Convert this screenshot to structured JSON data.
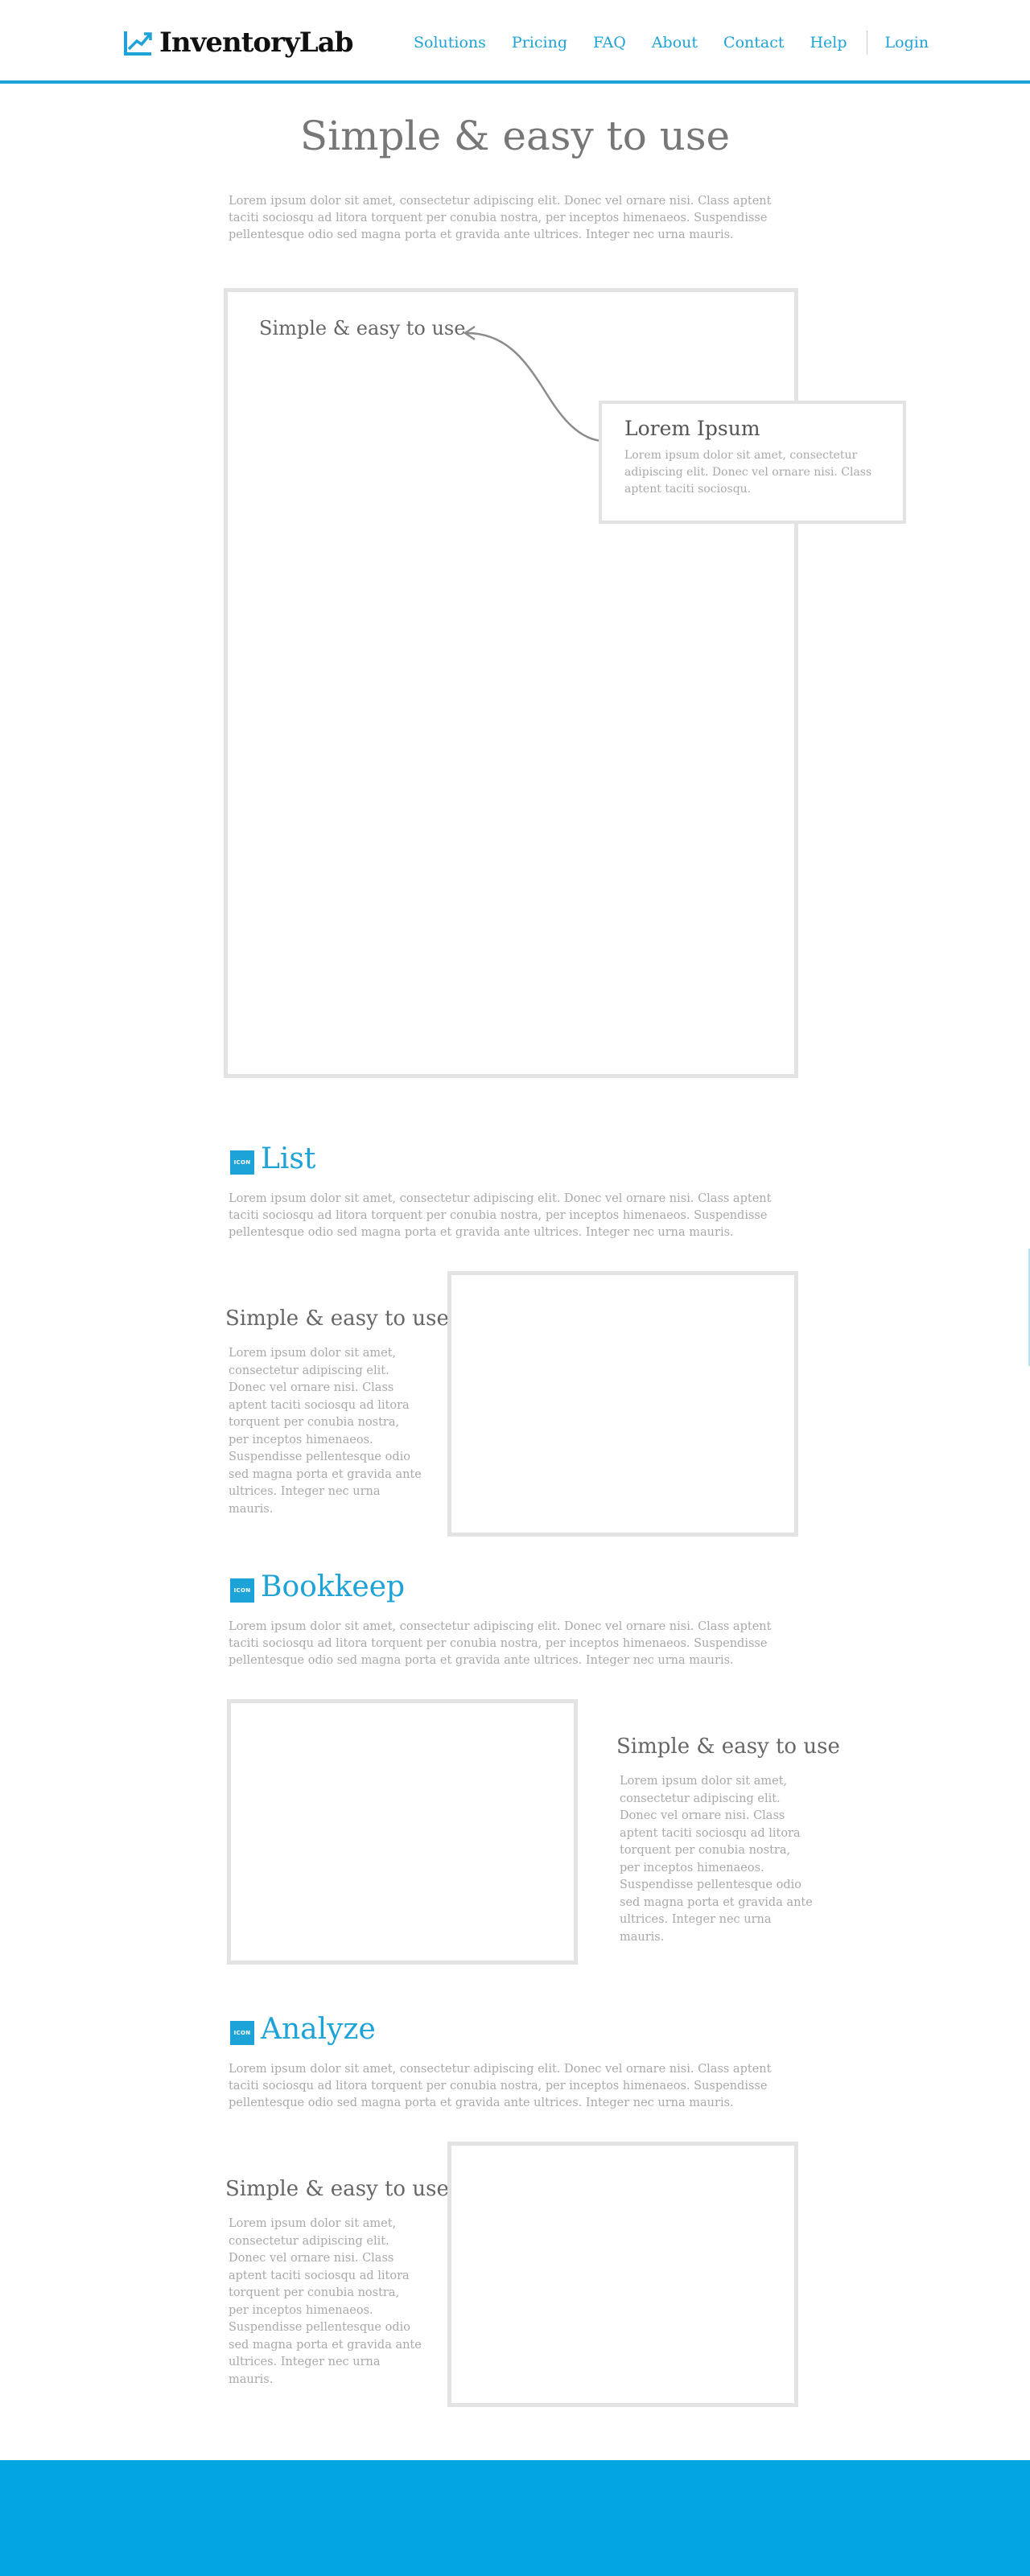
{
  "header": {
    "logo_text": "InventoryLab",
    "logo_icon": "chart-arrow-up-icon",
    "nav": [
      "Solutions",
      "Pricing",
      "FAQ",
      "About",
      "Contact",
      "Help"
    ],
    "login": "Login"
  },
  "hero": {
    "title": "Simple & easy to use",
    "intro": "Lorem ipsum dolor sit amet, consectetur adipiscing elit. Donec vel ornare nisi. Class aptent taciti sociosqu ad litora torquent per conubia nostra, per inceptos himenaeos. Suspendisse pellentesque odio sed magna porta et gravida ante ultrices. Integer nec urna mauris.",
    "frame_caption": "Simple & easy to use",
    "callout": {
      "title": "Lorem Ipsum",
      "text": "Lorem ipsum dolor sit amet, consectetur adipiscing elit. Donec vel ornare nisi. Class aptent taciti sociosqu."
    }
  },
  "sections": [
    {
      "icon_label": "ICON",
      "title": "List",
      "intro": "Lorem ipsum dolor sit amet, consectetur adipiscing elit. Donec vel ornare nisi. Class aptent taciti sociosqu ad litora torquent per conubia nostra, per inceptos himenaeos. Suspendisse pellentesque odio sed magna porta et gravida ante ultrices. Integer nec urna mauris.",
      "side_title": "Simple & easy to use",
      "side_text": "Lorem ipsum dolor sit amet, consectetur adipiscing elit. Donec vel ornare nisi. Class aptent taciti sociosqu ad litora torquent per conubia nostra, per inceptos himenaeos. Suspendisse pellentesque odio sed magna porta et gravida ante ultrices. Integer nec urna mauris."
    },
    {
      "icon_label": "ICON",
      "title": "Bookkeep",
      "intro": "Lorem ipsum dolor sit amet, consectetur adipiscing elit. Donec vel ornare nisi. Class aptent taciti sociosqu ad litora torquent per conubia nostra, per inceptos himenaeos. Suspendisse pellentesque odio sed magna porta et gravida ante ultrices. Integer nec urna mauris.",
      "side_title": "Simple & easy to use",
      "side_text": "Lorem ipsum dolor sit amet, consectetur adipiscing elit. Donec vel ornare nisi. Class aptent taciti sociosqu ad litora torquent per conubia nostra, per inceptos himenaeos. Suspendisse pellentesque odio sed magna porta et gravida ante ultrices. Integer nec urna mauris."
    },
    {
      "icon_label": "ICON",
      "title": "Analyze",
      "intro": "Lorem ipsum dolor sit amet, consectetur adipiscing elit. Donec vel ornare nisi. Class aptent taciti sociosqu ad litora torquent per conubia nostra, per inceptos himenaeos. Suspendisse pellentesque odio sed magna porta et gravida ante ultrices. Integer nec urna mauris.",
      "side_title": "Simple & easy to use",
      "side_text": "Lorem ipsum dolor sit amet, consectetur adipiscing elit. Donec vel ornare nisi. Class aptent taciti sociosqu ad litora torquent per conubia nostra, per inceptos himenaeos. Suspendisse pellentesque odio sed magna porta et gravida ante ultrices. Integer nec urna mauris."
    }
  ],
  "colors": {
    "accent": "#1ea3d8",
    "footer": "#03a6e0",
    "frame_border": "#e3e3e3",
    "body_text": "#a9a9a9"
  }
}
